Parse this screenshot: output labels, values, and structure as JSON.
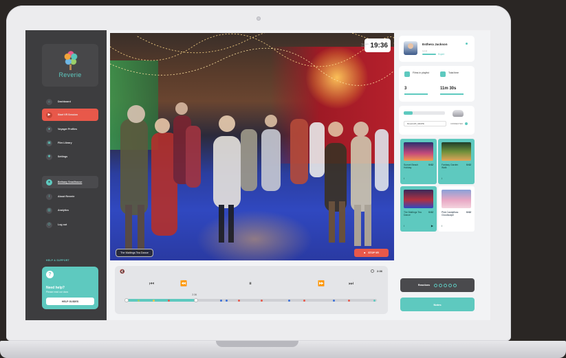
{
  "brand": {
    "logo_text": "Reverie"
  },
  "sidebar": {
    "items": [
      {
        "label": "Dashboard",
        "icon": "home-icon"
      },
      {
        "label": "Start VR Session",
        "icon": "play-icon",
        "active": true
      },
      {
        "label": "Voyager Profiles",
        "icon": "users-icon"
      },
      {
        "label": "Film Library",
        "icon": "film-icon"
      },
      {
        "label": "Settings",
        "icon": "gear-icon"
      }
    ],
    "user": {
      "label": "Bethany Smallhouse"
    },
    "secondary": [
      {
        "label": "About Reverie"
      },
      {
        "label": "Analytics"
      },
      {
        "label": "Log out"
      }
    ],
    "help": {
      "title": "HELP & SUPPORT",
      "heading": "Need help?",
      "sub": "Please read our docs",
      "button": "HELP GUIDES"
    }
  },
  "video": {
    "timer_label": "Session timer",
    "timer_value": "19:36",
    "film_title": "The Maltings Tea Dance",
    "stop_label": "STOP VR"
  },
  "player": {
    "volume_icon": "volume-mute-icon",
    "time_right": "2:36",
    "progress_label": "2:36",
    "progress_fraction": 0.28,
    "markers": [
      {
        "pos": 0.05,
        "color": "#9bd06b"
      },
      {
        "pos": 0.11,
        "color": "#f2c94c"
      },
      {
        "pos": 0.17,
        "color": "#e8584a"
      },
      {
        "pos": 0.38,
        "color": "#3a6fd8"
      },
      {
        "pos": 0.4,
        "color": "#3a6fd8"
      },
      {
        "pos": 0.45,
        "color": "#e8584a"
      },
      {
        "pos": 0.54,
        "color": "#e8584a"
      },
      {
        "pos": 0.65,
        "color": "#3a6fd8"
      },
      {
        "pos": 0.71,
        "color": "#e8584a"
      },
      {
        "pos": 0.83,
        "color": "#3a6fd8"
      },
      {
        "pos": 0.89,
        "color": "#e8584a"
      },
      {
        "pos": 0.99,
        "color": "#5ec9bf"
      }
    ]
  },
  "profile": {
    "name": "Esthera Jackson",
    "level_label": "Level",
    "level": "Expert"
  },
  "stats": {
    "films_label": "Films in playlist",
    "films_value": "3",
    "time_label": "Total time",
    "time_value": "11m 30s"
  },
  "connection": {
    "percent": "22%",
    "percent_value": 22,
    "device": "ReverieVR_GRAPE",
    "status": "CONNECTED"
  },
  "playlist": [
    {
      "name": "Sunset Beach Holiday",
      "duration": "0:02",
      "selected": true
    },
    {
      "name": "Fantasy Garden Walk",
      "duration": "0:02",
      "selected": true
    },
    {
      "name": "The Maltings Tea Dance",
      "duration": "0:02",
      "selected": true
    },
    {
      "name": "Pink Candyfloss Cloudscape",
      "duration": "0:02",
      "selected": false
    }
  ],
  "reactions": {
    "label": "Reactions"
  },
  "notes": {
    "label": "Notes"
  },
  "colors": {
    "accent": "#5ec9bf",
    "danger": "#e8584a",
    "sidebar": "#3d3d3f"
  }
}
